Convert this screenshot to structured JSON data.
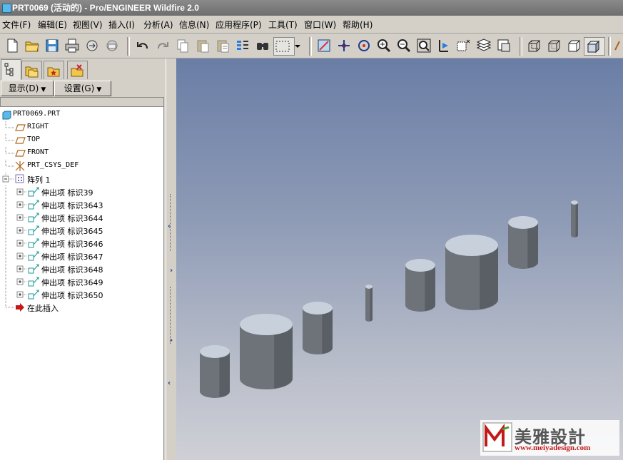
{
  "window": {
    "title": "PRT0069 (活动的) - Pro/ENGINEER Wildfire 2.0"
  },
  "menu": [
    {
      "label": "文件(F)"
    },
    {
      "label": "编辑(E)"
    },
    {
      "label": "视图(V)"
    },
    {
      "label": "插入(I)"
    },
    {
      "label": "分析(A)"
    },
    {
      "label": "信息(N)"
    },
    {
      "label": "应用程序(P)"
    },
    {
      "label": "工具(T)"
    },
    {
      "label": "窗口(W)"
    },
    {
      "label": "帮助(H)"
    }
  ],
  "toolbar_icons": [
    "new-icon",
    "open-icon",
    "save-icon",
    "print-icon",
    "send-icon",
    "email-icon",
    "undo-icon",
    "redo-icon",
    "copy-icon",
    "paste-icon",
    "paste-special-icon",
    "regenerate-icon",
    "find-icon",
    "select-box-icon",
    "dropdown-icon",
    "repaint-icon",
    "spin-center-icon",
    "orient-icon",
    "zoom-in-icon",
    "zoom-out-icon",
    "refit-icon",
    "reorient-icon",
    "saved-views-icon",
    "layers-icon",
    "view-manager-icon",
    "wireframe-icon",
    "hidden-line-icon",
    "no-hidden-icon",
    "shading-icon"
  ],
  "navigator": {
    "display_label": "显示(D)",
    "settings_label": "设置(G)"
  },
  "tree": {
    "root": "PRT0069.PRT",
    "datum": [
      "RIGHT",
      "TOP",
      "FRONT"
    ],
    "csys": "PRT_CSYS_DEF",
    "pattern": "阵列 1",
    "features": [
      "伸出项 标识39",
      "伸出项 标识3643",
      "伸出项 标识3644",
      "伸出项 标识3645",
      "伸出项 标识3646",
      "伸出项 标识3647",
      "伸出项 标识3648",
      "伸出项 标识3649",
      "伸出项 标识3650"
    ],
    "insert_here": "在此插入"
  },
  "colors": {
    "cylinder_side": "#6e737a",
    "cylinder_top": "#c8d0dc",
    "viewport_top": "#6a7ea6",
    "viewport_bottom": "#cfd0d6"
  },
  "watermark": {
    "text": "美雅設計",
    "url": "www.meiyadesign.com"
  }
}
